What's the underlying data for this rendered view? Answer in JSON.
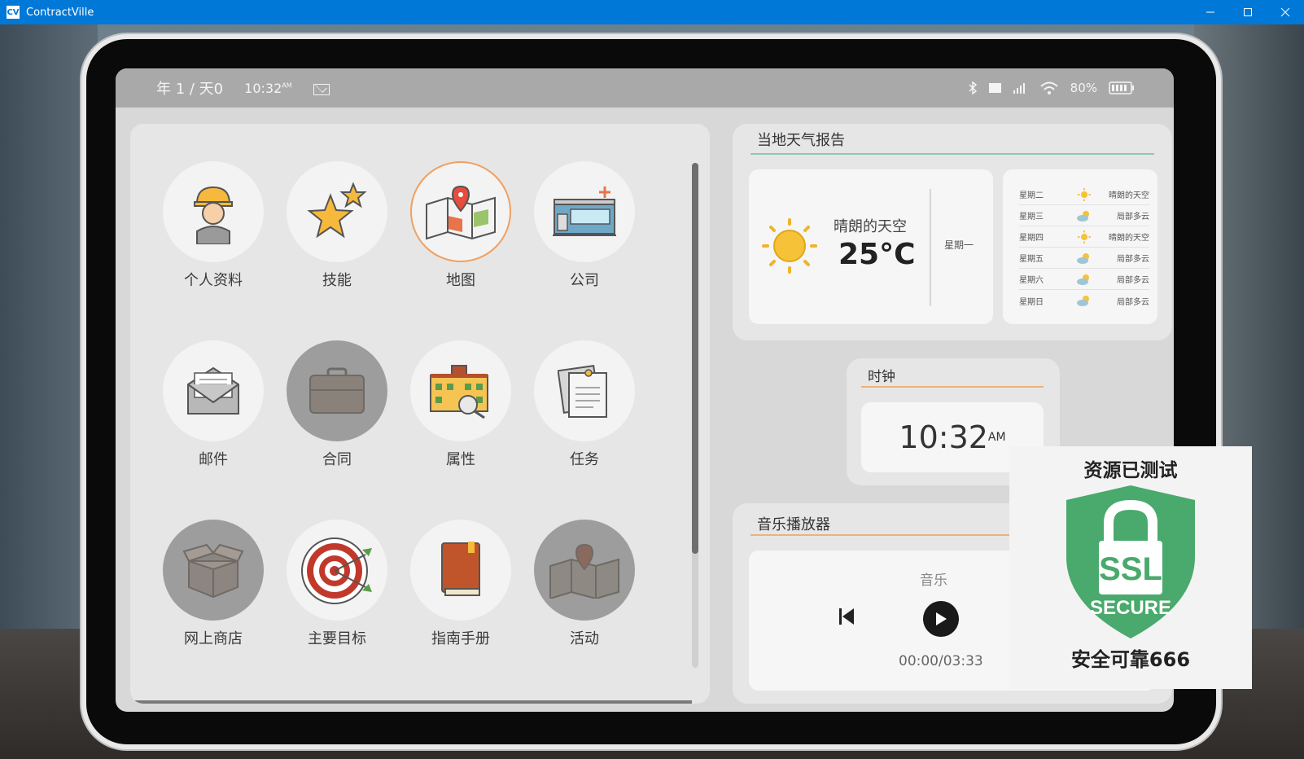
{
  "window": {
    "title": "ContractVille",
    "icon_text": "CV",
    "controls": [
      "minimize-icon",
      "maximize-icon",
      "close-icon"
    ]
  },
  "statusbar": {
    "date": "年 1 / 天0",
    "time": "10:32",
    "ampm": "AM",
    "battery": "80%"
  },
  "apps": [
    {
      "label": "个人资料",
      "name": "profile",
      "icon": "worker-icon",
      "state": "normal"
    },
    {
      "label": "技能",
      "name": "skills",
      "icon": "star-icon",
      "state": "normal"
    },
    {
      "label": "地图",
      "name": "map",
      "icon": "map-icon",
      "state": "active"
    },
    {
      "label": "公司",
      "name": "company",
      "icon": "company-building-icon",
      "state": "normal"
    },
    {
      "label": "邮件",
      "name": "mail",
      "icon": "envelope-icon",
      "state": "normal"
    },
    {
      "label": "合同",
      "name": "contracts",
      "icon": "briefcase-icon",
      "state": "dim"
    },
    {
      "label": "属性",
      "name": "properties",
      "icon": "property-search-icon",
      "state": "normal"
    },
    {
      "label": "任务",
      "name": "tasks",
      "icon": "notes-icon",
      "state": "normal"
    },
    {
      "label": "网上商店",
      "name": "shop",
      "icon": "box-icon",
      "state": "dim"
    },
    {
      "label": "主要目标",
      "name": "goals",
      "icon": "target-icon",
      "state": "normal"
    },
    {
      "label": "指南手册",
      "name": "guide",
      "icon": "book-icon",
      "state": "normal"
    },
    {
      "label": "活动",
      "name": "activities",
      "icon": "map-pin-icon",
      "state": "dim"
    }
  ],
  "weather": {
    "title": "当地天气报告",
    "condition": "晴朗的天空",
    "temp": "25°C",
    "today_day": "星期一",
    "forecast": [
      {
        "day": "星期二",
        "icon": "sun-icon",
        "cond": "晴朗的天空"
      },
      {
        "day": "星期三",
        "icon": "partly-cloudy-icon",
        "cond": "局部多云"
      },
      {
        "day": "星期四",
        "icon": "sun-icon",
        "cond": "晴朗的天空"
      },
      {
        "day": "星期五",
        "icon": "partly-cloudy-icon",
        "cond": "局部多云"
      },
      {
        "day": "星期六",
        "icon": "partly-cloudy-icon",
        "cond": "局部多云"
      },
      {
        "day": "星期日",
        "icon": "partly-cloudy-icon",
        "cond": "局部多云"
      }
    ]
  },
  "clock": {
    "title": "时钟",
    "time": "10:32",
    "ampm": "AM"
  },
  "music": {
    "title": "音乐播放器",
    "track": "音乐",
    "progress": "00:00/03:33"
  },
  "stamp": {
    "top": "资源已测试",
    "bottom": "安全可靠666",
    "badge_line1": "SSL",
    "badge_line2": "SECURE"
  },
  "colors": {
    "accent_orange": "#f0a060",
    "weather_rule": "#8fc6b6",
    "ssl_green": "#4aa96c",
    "titlebar": "#0078d7"
  }
}
